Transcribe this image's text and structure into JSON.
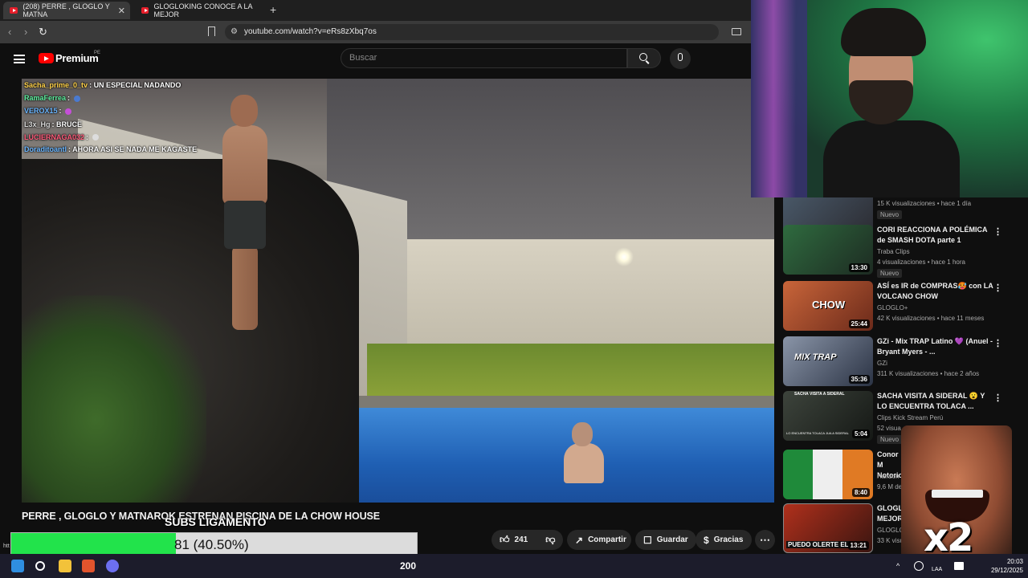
{
  "browser": {
    "tabs": [
      {
        "label": "(208) PERRE , GLOGLO Y MATNA",
        "active": true
      },
      {
        "label": "GLOGLOKING CONOCE A LA MEJOR",
        "active": false
      }
    ],
    "url": "youtube.com/watch?v=eRs8zXbq7os"
  },
  "youtube": {
    "logo_text": "Premium",
    "logo_region": "PE",
    "search_placeholder": "Buscar"
  },
  "chat": [
    {
      "user": "Sacha_prime_0_tv",
      "user_color": "#ffd24a",
      "message": "UN ESPECIAL NADANDO"
    },
    {
      "user": "RamaFerrea",
      "user_color": "#5ff0a0",
      "message": ""
    },
    {
      "user": "VEROX15",
      "user_color": "#6bb6ff",
      "message": ""
    },
    {
      "user": "L3x_Hg",
      "user_color": "#d9d9d9",
      "message": "BRUCE"
    },
    {
      "user": "LUCIERNAGA032",
      "user_color": "#ff5a7a",
      "message": ""
    },
    {
      "user": "Doraditoantl",
      "user_color": "#6bb6ff",
      "message": "AHORA ASI SE NADA ME KAGASTE"
    }
  ],
  "video": {
    "title": "PERRE , GLOGLO Y MATNAROK ESTRENAN PISCINA DE LA CHOW HOUSE",
    "likes": "241",
    "share_label": "Compartir",
    "save_label": "Guardar",
    "thanks_label": "Gracias"
  },
  "recommendations": [
    {
      "title": "",
      "channel": "",
      "meta": "15 K visualizaciones • hace 1 día",
      "badge": "Nuevo",
      "duration": "",
      "thumb_color": "#4a5a6a"
    },
    {
      "title": "CORI REACCIONA A POLÉMICA de SMASH DOTA parte 1",
      "channel": "Traba Clips",
      "meta": "4 visualizaciones • hace 1 hora",
      "badge": "Nuevo",
      "duration": "13:30",
      "thumb_color": "#2f6b3f"
    },
    {
      "title": "ASÍ es IR de COMPRAS🥵 con LA VOLCANO CHOW",
      "channel": "GLOGLO+",
      "meta": "42 K visualizaciones • hace 11 meses",
      "badge": "",
      "duration": "25:44",
      "thumb_color": "#c9653a"
    },
    {
      "title": "GZi - Mix TRAP Latino 💜 (Anuel - Bryant Myers - ...",
      "channel": "GZi",
      "meta": "311 K visualizaciones • hace 2 años",
      "badge": "",
      "duration": "35:36",
      "thumb_color": "#3b4a66"
    },
    {
      "title": "SACHA VISITA A SIDERAL 😮 Y LO ENCUENTRA TOLACA ...",
      "channel": "Clips Kick Stream Perú",
      "meta": "52 visua",
      "badge": "Nuevo",
      "duration": "5:04",
      "thumb_color": "#2a2e2a"
    },
    {
      "title": "Conor M Notorio",
      "channel": "Hanson",
      "meta": "9,6 M de",
      "badge": "",
      "duration": "8:40",
      "thumb_color": "#3a7a3a"
    },
    {
      "title": "GLOGLO MEJOR",
      "channel": "GLOGLO",
      "meta": "33 K visualizaciones • hace 1",
      "badge": "",
      "duration": "13:21",
      "thumb_color": "#b0301c"
    }
  ],
  "thumb_captions": {
    "rec2": "CHOW",
    "rec3": "MIX TRAP",
    "rec4": "SACHA VISITA A SIDERAL",
    "rec4b": "LO ENCUENTRA TOLACA JUA A SIDERAL",
    "rec6": "PUEDO OLERTE EL"
  },
  "goal": {
    "label": "SUBS LIGAMENTO",
    "text": "81 (40.50%)",
    "progress": 0.405,
    "fill_color": "#22e34b"
  },
  "meme_overlay": {
    "label": "x2"
  },
  "taskbar": {
    "count": "200",
    "lang": "LAA",
    "time": "20:03",
    "date": "29/12/2025"
  },
  "url_hint": "htt"
}
